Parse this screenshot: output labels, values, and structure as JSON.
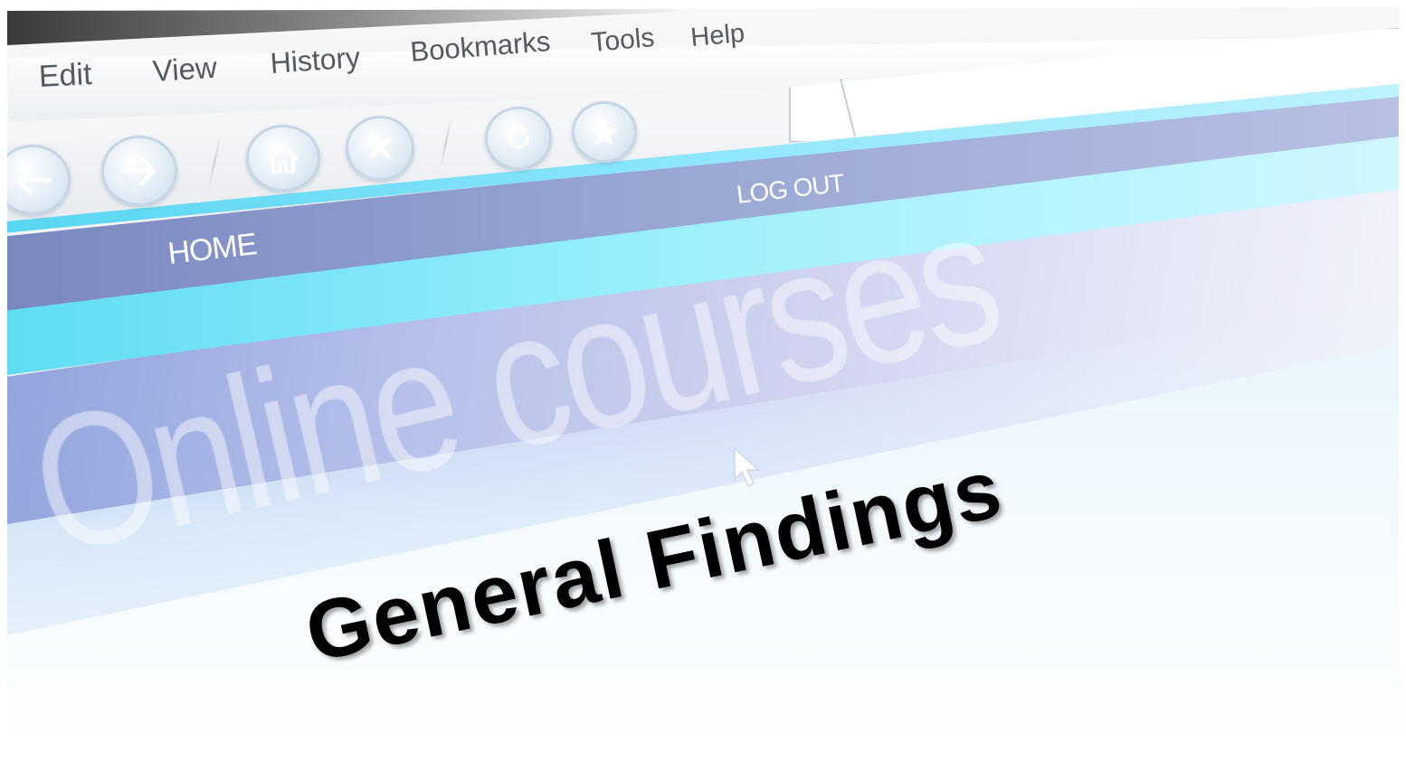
{
  "menu": {
    "edit": "Edit",
    "view": "View",
    "history": "History",
    "bookmarks": "Bookmarks",
    "tools": "Tools",
    "help": "Help"
  },
  "toolbar": {
    "icons": [
      "back-arrow-icon",
      "forward-arrow-icon",
      "home-icon",
      "stop-icon",
      "reload-icon",
      "star-icon"
    ]
  },
  "site_nav": {
    "home": "HOME",
    "logout": "LOG OUT"
  },
  "hero": {
    "title": "Online courses"
  },
  "caption": "General Findings",
  "colors": {
    "nav_band": "#8a98cc",
    "accent_cyan": "#7fe3f8",
    "caption_text": "#000000",
    "menu_text": "#555a60"
  }
}
